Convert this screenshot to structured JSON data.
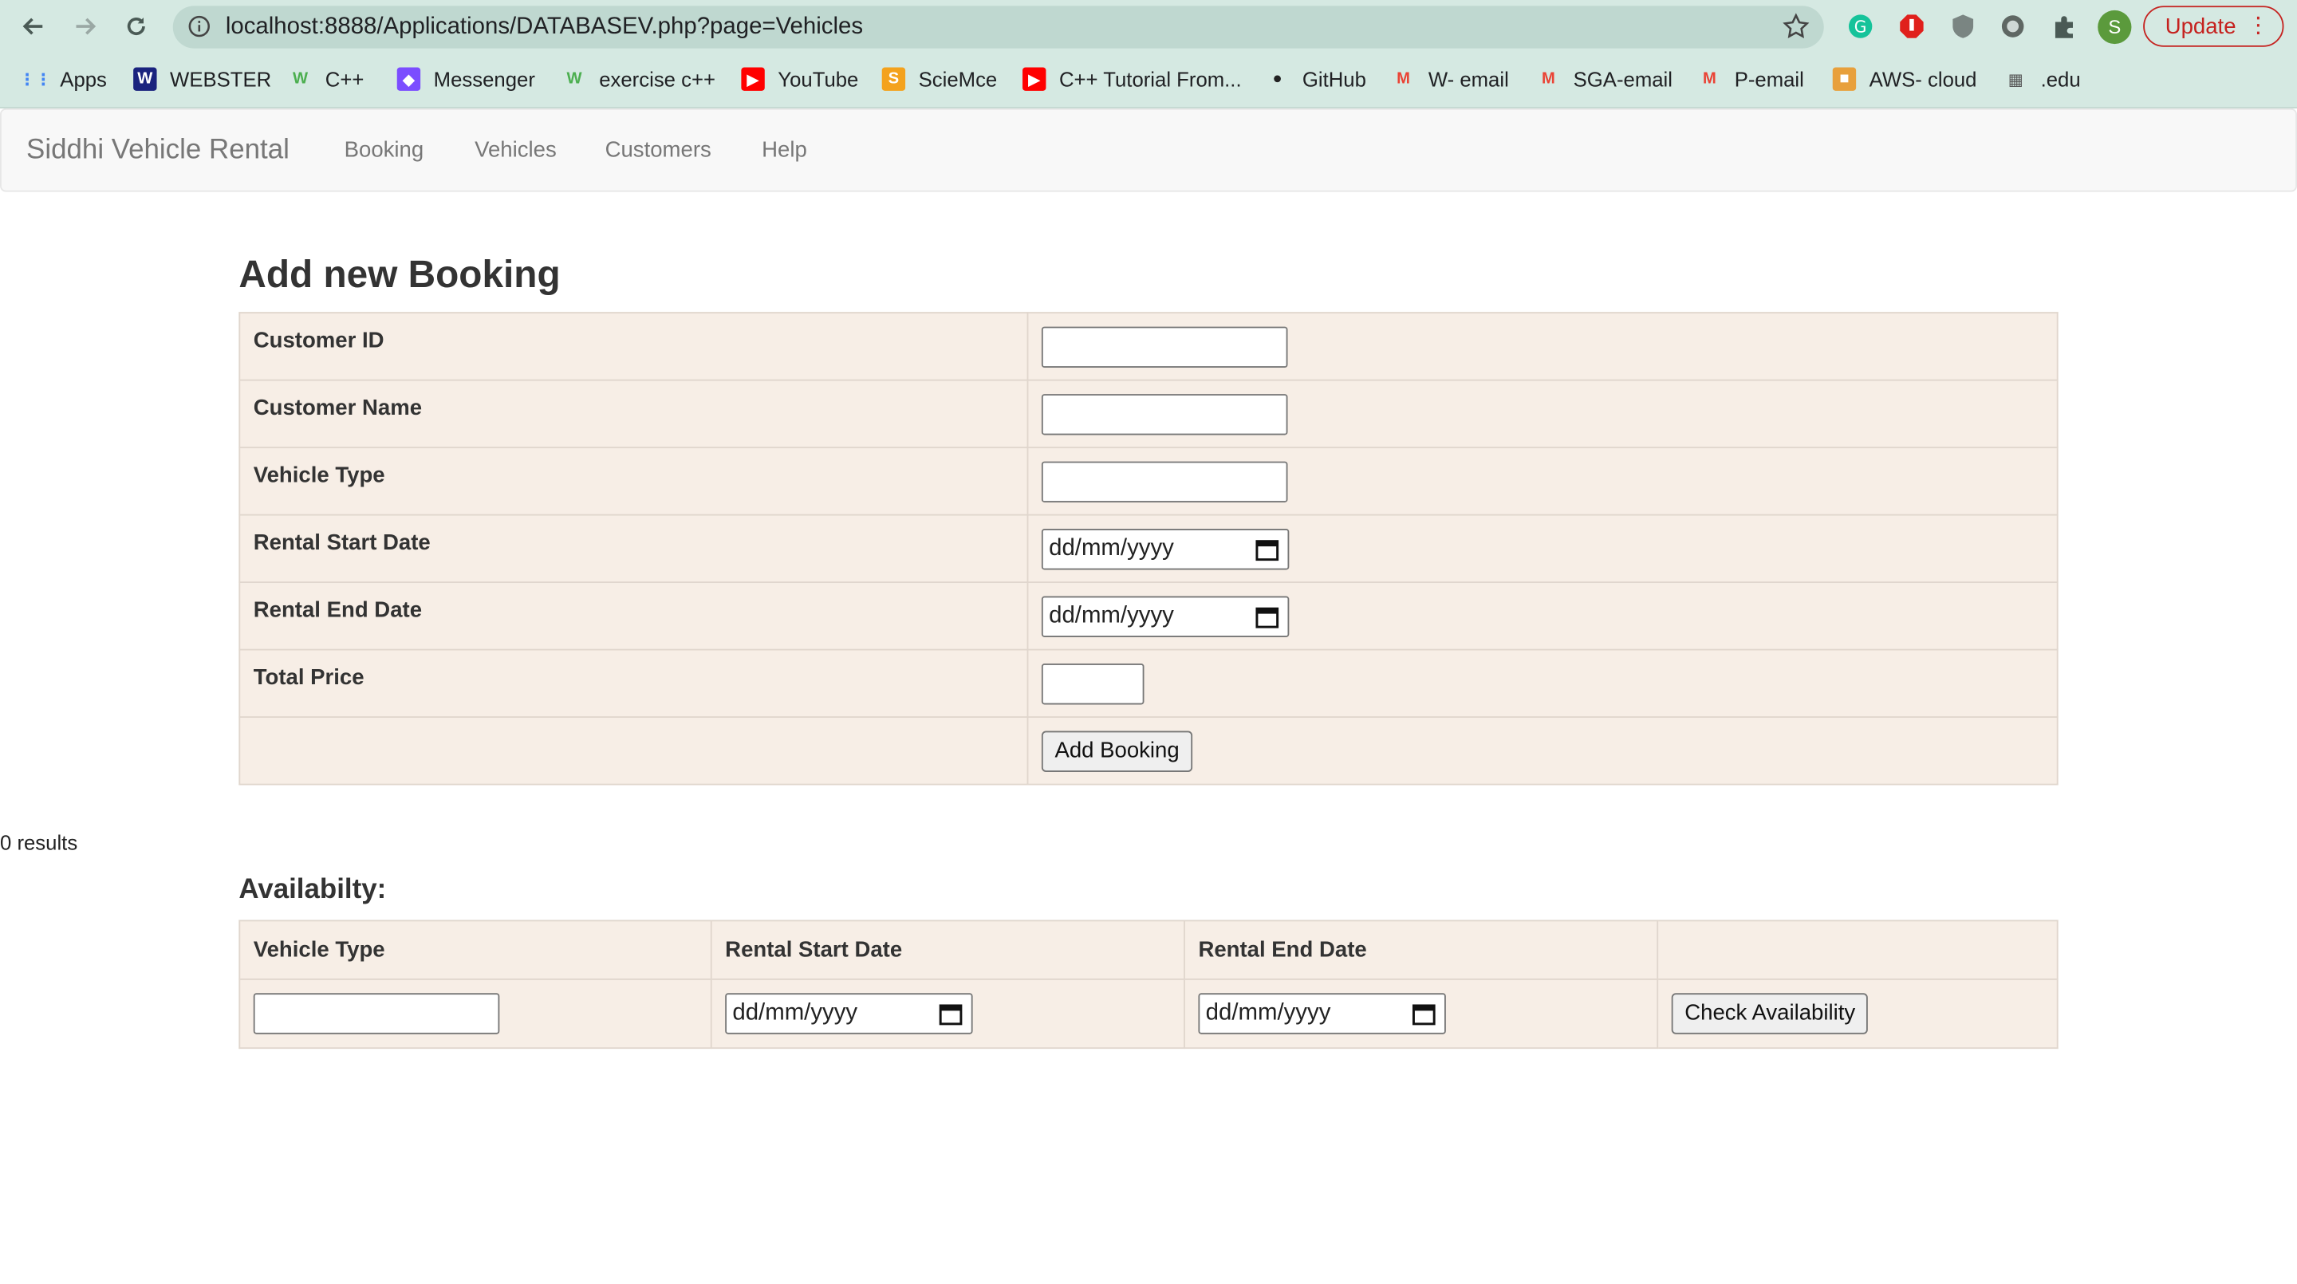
{
  "browser": {
    "url": "localhost:8888/Applications/DATABASEV.php?page=Vehicles",
    "update_label": "Update",
    "profile_initial": "S",
    "bookmarks": [
      {
        "label": "Apps",
        "icon": "apps-grid-icon",
        "color": "#4285f4"
      },
      {
        "label": "WEBSTER",
        "icon": "webster-icon",
        "color": "#1a237e"
      },
      {
        "label": "C++",
        "icon": "w3-icon",
        "color": "#4caf50"
      },
      {
        "label": "Messenger",
        "icon": "messenger-icon",
        "color": "#7b4dff"
      },
      {
        "label": "exercise c++",
        "icon": "w3-icon",
        "color": "#4caf50"
      },
      {
        "label": "YouTube",
        "icon": "youtube-icon",
        "color": "#ff0000"
      },
      {
        "label": "ScieMce",
        "icon": "sciemce-icon",
        "color": "#f4a21d"
      },
      {
        "label": "C++ Tutorial From...",
        "icon": "youtube-icon",
        "color": "#ff0000"
      },
      {
        "label": "GitHub",
        "icon": "github-icon",
        "color": "#ffffff"
      },
      {
        "label": "W- email",
        "icon": "gmail-icon",
        "color": "#ea4335"
      },
      {
        "label": "SGA-email",
        "icon": "gmail-icon",
        "color": "#ea4335"
      },
      {
        "label": "P-email",
        "icon": "gmail-icon",
        "color": "#ea4335"
      },
      {
        "label": "AWS- cloud",
        "icon": "aws-box-icon",
        "color": "#e8a03c"
      },
      {
        "label": ".edu",
        "icon": "edu-icon",
        "color": "#555555"
      }
    ]
  },
  "app": {
    "brand": "Siddhi Vehicle Rental",
    "nav": [
      "Booking",
      "Vehicles",
      "Customers",
      "Help"
    ]
  },
  "booking_form": {
    "title": "Add new Booking",
    "fields": [
      {
        "label": "Customer ID",
        "type": "text",
        "value": ""
      },
      {
        "label": "Customer Name",
        "type": "text",
        "value": ""
      },
      {
        "label": "Vehicle Type",
        "type": "text",
        "value": ""
      },
      {
        "label": "Rental Start Date",
        "type": "date",
        "placeholder": "dd/mm/yyyy"
      },
      {
        "label": "Rental End Date",
        "type": "date",
        "placeholder": "dd/mm/yyyy"
      },
      {
        "label": "Total Price",
        "type": "text",
        "value": ""
      }
    ],
    "submit_label": "Add Booking"
  },
  "results_text": "0 results",
  "availability": {
    "title": "Availabilty:",
    "headers": [
      "Vehicle Type",
      "Rental Start Date",
      "Rental End Date",
      ""
    ],
    "start_placeholder": "dd/mm/yyyy",
    "end_placeholder": "dd/mm/yyyy",
    "button_label": "Check Availability"
  },
  "colors": {
    "chrome_bg": "#d5e9e2",
    "table_bg": "#f7eee6",
    "update_red": "#c5221f"
  }
}
